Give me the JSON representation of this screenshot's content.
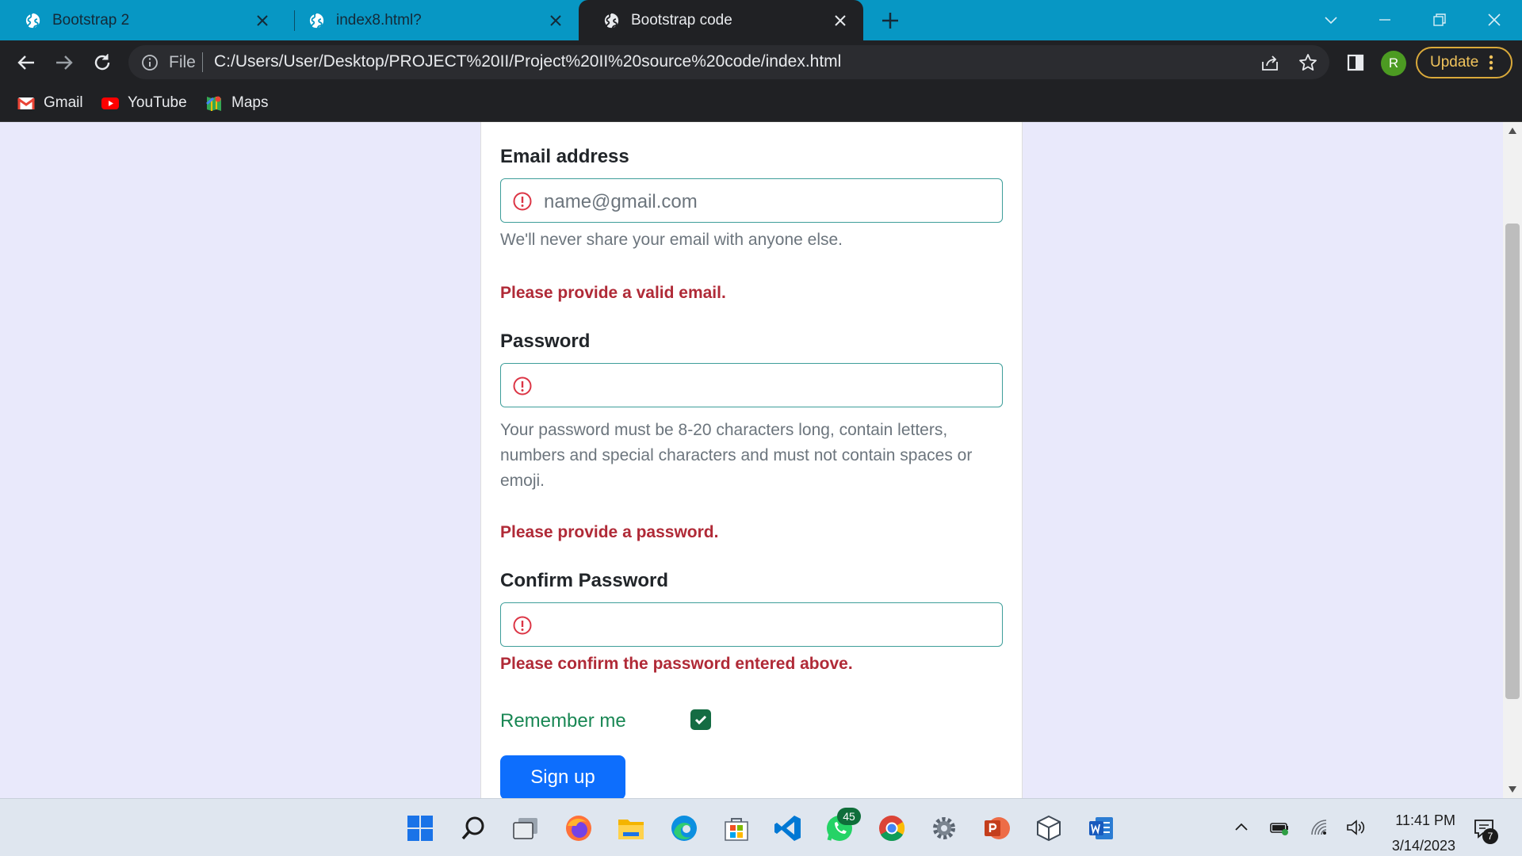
{
  "browser": {
    "tabs": [
      {
        "title": "Bootstrap 2",
        "active": false
      },
      {
        "title": "index8.html?",
        "active": false
      },
      {
        "title": "Bootstrap code",
        "active": true
      }
    ],
    "address": {
      "scheme_label": "File",
      "url": "C:/Users/User/Desktop/PROJECT%20II/Project%20II%20source%20code/index.html"
    },
    "profile_initial": "R",
    "update_label": "Update",
    "bookmarks": [
      {
        "label": "Gmail",
        "icon": "gmail-icon"
      },
      {
        "label": "YouTube",
        "icon": "youtube-icon"
      },
      {
        "label": "Maps",
        "icon": "maps-icon"
      }
    ]
  },
  "form": {
    "email": {
      "label": "Email address",
      "placeholder": "name@gmail.com",
      "help": "We'll never share your email with anyone else.",
      "invalid": "Please provide a valid email."
    },
    "password": {
      "label": "Password",
      "help": "Your password must be 8-20 characters long, contain letters, numbers and special characters and must not contain spaces or emoji.",
      "invalid": "Please provide a password."
    },
    "confirm": {
      "label": "Confirm Password",
      "invalid": "Please confirm the password entered above."
    },
    "remember": {
      "label": "Remember me",
      "checked": true
    },
    "submit_label": "Sign up"
  },
  "taskbar": {
    "apps": [
      "windows-start",
      "search",
      "task-view",
      "firefox",
      "file-explorer",
      "edge",
      "microsoft-store",
      "vs-code",
      "whatsapp",
      "chrome",
      "settings",
      "powerpoint",
      "virtualbox",
      "word"
    ],
    "whatsapp_badge": "45",
    "time": "11:41 PM",
    "date": "3/14/2023",
    "notifications": "7"
  },
  "colors": {
    "tab_bar": "#0797c4",
    "invalid_text": "#b02a37",
    "valid_text": "#198754",
    "primary": "#0d6efd"
  }
}
